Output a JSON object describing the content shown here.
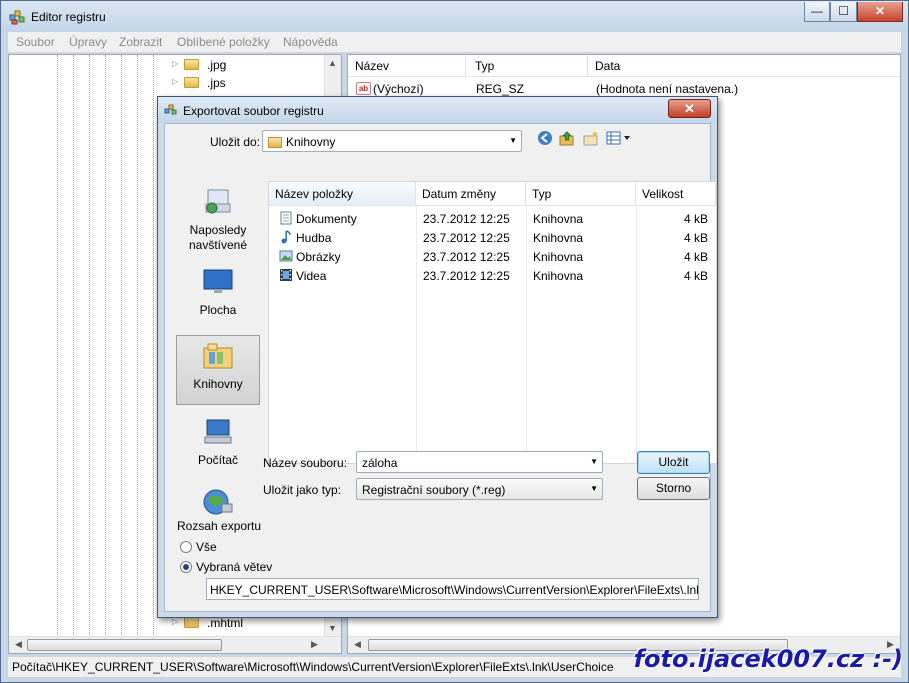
{
  "window": {
    "title": "Editor registru",
    "controls": {
      "minimize": "—",
      "maximize": "☐",
      "close": "✕"
    }
  },
  "menu": [
    "Soubor",
    "Úpravy",
    "Zobrazit",
    "Oblíbené položky",
    "Nápověda"
  ],
  "tree": {
    "items": [
      ".jpg",
      ".jps"
    ],
    "bottom_item": ".mhtml"
  },
  "list": {
    "columns": [
      "Název",
      "Typ",
      "Data"
    ],
    "rows": [
      {
        "name": "(Výchozí)",
        "type": "REG_SZ",
        "data": "(Hodnota není nastavena.)"
      }
    ]
  },
  "status": {
    "path": "Počítač\\HKEY_CURRENT_USER\\Software\\Microsoft\\Windows\\CurrentVersion\\Explorer\\FileExts\\.lnk\\UserChoice"
  },
  "watermark": "foto.ijacek007.cz :-)",
  "dialog": {
    "title": "Exportovat soubor registru",
    "close_glyph": "✕",
    "save_in_label": "Uložit do:",
    "save_in_value": "Knihovny",
    "places": [
      {
        "label": "Naposledy navštívené",
        "icon": "recent-places-icon"
      },
      {
        "label": "Plocha",
        "icon": "desktop-icon"
      },
      {
        "label": "Knihovny",
        "icon": "libraries-icon",
        "selected": true
      },
      {
        "label": "Počítač",
        "icon": "computer-icon"
      },
      {
        "label": "",
        "icon": "network-icon"
      }
    ],
    "file_columns": [
      "Název položky",
      "Datum změny",
      "Typ",
      "Velikost"
    ],
    "files": [
      {
        "name": "Dokumenty",
        "date": "23.7.2012 12:25",
        "type": "Knihovna",
        "size": "4 kB",
        "icon": "documents-icon"
      },
      {
        "name": "Hudba",
        "date": "23.7.2012 12:25",
        "type": "Knihovna",
        "size": "4 kB",
        "icon": "music-icon"
      },
      {
        "name": "Obrázky",
        "date": "23.7.2012 12:25",
        "type": "Knihovna",
        "size": "4 kB",
        "icon": "pictures-icon"
      },
      {
        "name": "Videa",
        "date": "23.7.2012 12:25",
        "type": "Knihovna",
        "size": "4 kB",
        "icon": "videos-icon"
      }
    ],
    "filename_label": "Název souboru:",
    "filename_value": "záloha",
    "filetype_label": "Uložit jako typ:",
    "filetype_value": "Registrační soubory (*.reg)",
    "save_button": "Uložit",
    "cancel_button": "Storno",
    "export_range": {
      "label": "Rozsah exportu",
      "option_all": "Vše",
      "option_branch": "Vybraná větev",
      "selected": "Vybraná větev",
      "branch_path": "HKEY_CURRENT_USER\\Software\\Microsoft\\Windows\\CurrentVersion\\Explorer\\FileExts\\.lnk\\UserCh"
    }
  }
}
